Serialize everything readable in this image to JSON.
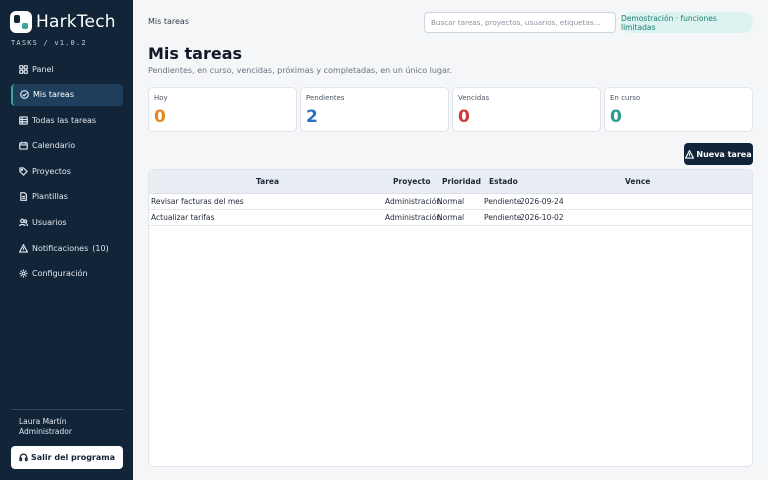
{
  "brand": {
    "name": "HarkTech",
    "subtitle": "TASKS / v1.0.2"
  },
  "sidebar": {
    "items": [
      {
        "label": "Panel",
        "icon": "grid-icon"
      },
      {
        "label": "Mis tareas",
        "icon": "check-circle-icon",
        "active": true
      },
      {
        "label": "Todas las tareas",
        "icon": "list-icon"
      },
      {
        "label": "Calendario",
        "icon": "calendar-icon"
      },
      {
        "label": "Proyectos",
        "icon": "tag-icon"
      },
      {
        "label": "Plantillas",
        "icon": "document-icon"
      },
      {
        "label": "Usuarios",
        "icon": "users-icon"
      },
      {
        "label": "Notificaciones",
        "icon": "warning-icon",
        "count": "(10)"
      },
      {
        "label": "Configuración",
        "icon": "settings-icon"
      }
    ],
    "user": {
      "name": "Laura Martín",
      "role": "Administrador"
    },
    "exit_label": "Salir del programa"
  },
  "topbar": {
    "breadcrumb": "Mis tareas",
    "search_placeholder": "Buscar tareas, proyectos, usuarios, etiquetas...",
    "demo_label": "Demostración · funciones limitadas"
  },
  "header": {
    "title": "Mis tareas",
    "subtitle": "Pendientes, en curso, vencidas, próximas y completadas, en un único lugar."
  },
  "stats": [
    {
      "label": "Hoy",
      "value": "0",
      "color": "#e08a1e"
    },
    {
      "label": "Pendientes",
      "value": "2",
      "color": "#2f6fbf"
    },
    {
      "label": "Vencidas",
      "value": "0",
      "color": "#d13a3a"
    },
    {
      "label": "En curso",
      "value": "0",
      "color": "#2a9d8f"
    }
  ],
  "new_task_label": "Nueva tarea",
  "table": {
    "columns": [
      "Tarea",
      "Proyecto",
      "Prioridad",
      "Estado",
      "Vence"
    ],
    "rows": [
      [
        "Revisar facturas del mes",
        "Administración",
        "Normal",
        "Pendiente",
        "2026-09-24"
      ],
      [
        "Actualizar tarifas",
        "Administración",
        "Normal",
        "Pendiente",
        "2026-10-02"
      ]
    ]
  },
  "colors": {
    "sidebar": "#122437",
    "accent": "#3aa39a"
  }
}
